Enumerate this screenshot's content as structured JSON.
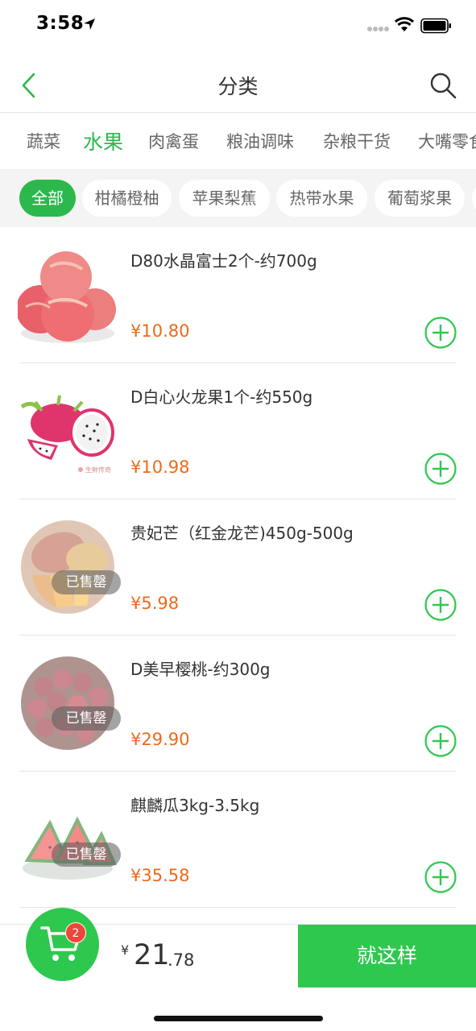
{
  "status": {
    "time": "3:58"
  },
  "nav": {
    "title": "分类"
  },
  "categories": [
    "蔬菜",
    "水果",
    "肉禽蛋",
    "粮油调味",
    "杂粮干货",
    "大嘴零食"
  ],
  "active_category": "水果",
  "subcategories": [
    "全部",
    "柑橘橙柚",
    "苹果梨蕉",
    "热带水果",
    "葡萄浆果"
  ],
  "products": [
    {
      "name": "D80水晶富士2个-约700g",
      "price": "¥10.80",
      "sold_out": false,
      "image": "apple"
    },
    {
      "name": "D白心火龙果1个-约550g",
      "price": "¥10.98",
      "sold_out": false,
      "image": "dragon-fruit",
      "watermark": "生鲜传奇"
    },
    {
      "name": "贵妃芒（红金龙芒)450g-500g",
      "price": "¥5.98",
      "sold_out": true,
      "sold_label": "已售罄",
      "image": "mango"
    },
    {
      "name": "D美早樱桃-约300g",
      "price": "¥29.90",
      "sold_out": true,
      "sold_label": "已售罄",
      "image": "cherry"
    },
    {
      "name": "麒麟瓜3kg-3.5kg",
      "price": "¥35.58",
      "sold_out": true,
      "sold_label": "已售罄",
      "image": "watermelon"
    }
  ],
  "cart": {
    "badge": "2",
    "currency": "¥",
    "total_int": "21",
    "total_dec": ".78",
    "checkout_label": "就这样"
  },
  "colors": {
    "brand_green": "#2ec84f",
    "price_orange": "#ec6a1b",
    "badge_red": "#f0453a"
  }
}
